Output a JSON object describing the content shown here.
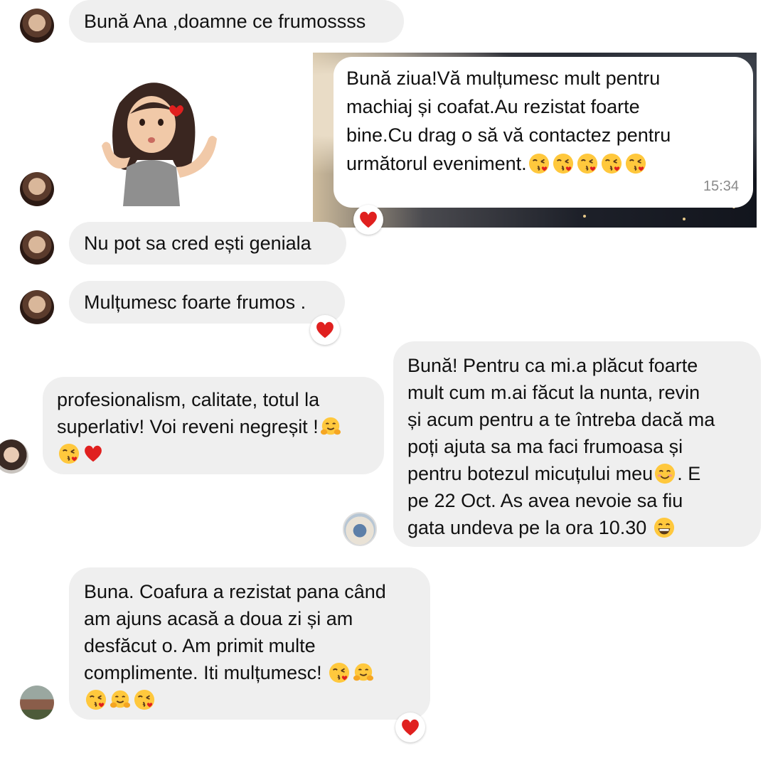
{
  "conversation": [
    {
      "id": "m1",
      "from": "contact",
      "avatar": "elderly-woman-avatar",
      "text": "Bună Ana ,doamne ce frumossss"
    },
    {
      "id": "m2",
      "from": "contact",
      "avatar": "elderly-woman-avatar",
      "sticker": "avatar-sticker-blowing-kiss"
    },
    {
      "id": "m3",
      "from": "me",
      "reply_text": "Bună ziua!Vă mulțumesc mult pentru machiaj și coafat.Au rezistat foarte bine.Cu drag o să vă contactez pentru următorul eveniment.",
      "reply_emojis": [
        "kissing-heart-emoji",
        "kissing-heart-emoji",
        "kissing-heart-emoji",
        "kissing-heart-emoji",
        "kissing-heart-emoji"
      ],
      "time": "15:34",
      "reaction": "heart-reaction"
    },
    {
      "id": "m4",
      "from": "contact",
      "avatar": "elderly-woman-avatar",
      "text": "Nu pot sa cred ești geniala"
    },
    {
      "id": "m5",
      "from": "contact",
      "avatar": "elderly-woman-avatar",
      "text": "Mulțumesc foarte frumos .",
      "reaction": "heart-reaction"
    },
    {
      "id": "m6",
      "from": "contact",
      "avatar": "woman-avatar",
      "text": "profesionalism, calitate, totul la superlativ! Voi reveni negreșit !",
      "emojis": [
        "hugging-emoji",
        "kissing-heart-emoji",
        "red-heart-emoji"
      ]
    },
    {
      "id": "m7",
      "from": "contact",
      "avatar": "family-avatar",
      "text": "Bună! Pentru ca mi.a plăcut foarte mult cum m.ai făcut la nunta, revin și acum pentru a te întreba dacă ma poți ajuta sa ma faci frumoasa și pentru botezul micuțului meu. E pe 22 Oct. As avea nevoie sa fiu gata undeva pe la ora 10.30",
      "emojis": [
        "smiling-emoji",
        "grinning-emoji"
      ]
    },
    {
      "id": "m8",
      "from": "contact",
      "avatar": "outdoor-avatar",
      "text": "Buna. Coafura a rezistat pana când am ajuns acasă a doua zi și am desfăcut o. Am primit multe complimente. Iti mulțumesc!",
      "emojis": [
        "kissing-heart-emoji",
        "hugging-emoji",
        "kissing-heart-emoji",
        "hugging-emoji",
        "kissing-heart-emoji"
      ],
      "reaction": "heart-reaction"
    }
  ],
  "lines": {
    "m1": "Bună Ana ,doamne ce frumossss",
    "m3": [
      "Bună ziua!Vă mulțumesc mult pentru",
      "machiaj și coafat.Au rezistat foarte",
      "bine.Cu drag o să vă contactez pentru",
      "următorul eveniment."
    ],
    "m3_time": "15:34",
    "m4": "Nu pot sa cred ești geniala",
    "m5": "Mulțumesc foarte frumos .",
    "m6": [
      "profesionalism, calitate, totul la",
      "superlativ! Voi reveni negreșit !"
    ],
    "m7": [
      "Bună! Pentru ca mi.a plăcut foarte",
      "mult cum m.ai făcut la nunta, revin",
      "și acum pentru a te întreba dacă ma",
      "poți ajuta sa ma faci frumoasa și",
      "pentru botezul micuțului meu",
      ". E",
      "pe 22 Oct. As avea nevoie sa fiu",
      "gata undeva pe la ora 10.30"
    ],
    "m8": [
      "Buna. Coafura a rezistat pana când",
      "am ajuns acasă a doua zi și am",
      "desfăcut o. Am primit multe",
      "complimente. Iti mulțumesc!"
    ]
  },
  "colors": {
    "bubble": "#efefef",
    "background": "#ffffff",
    "heart": "#e0201f",
    "emoji_face": "#ffc83d",
    "timestamp": "#8a8a8a"
  }
}
